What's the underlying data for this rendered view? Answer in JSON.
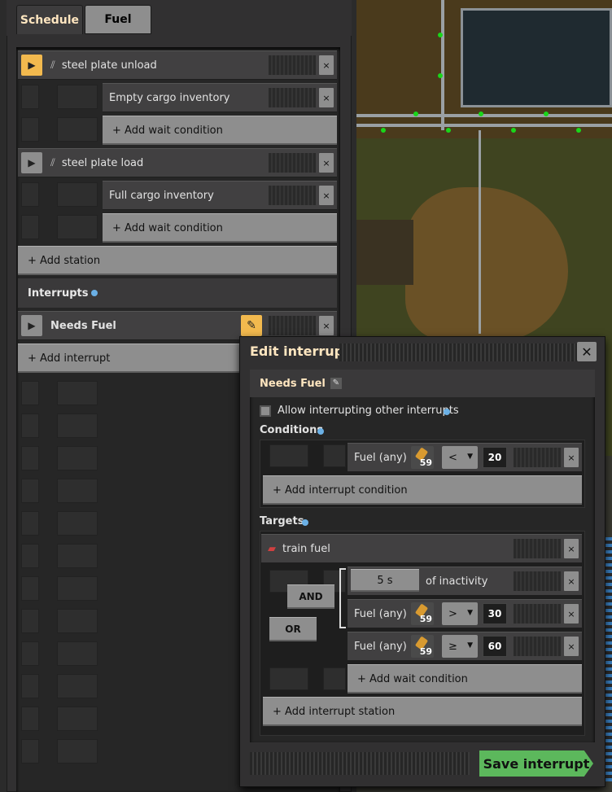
{
  "tabs": [
    {
      "label": "Schedule"
    },
    {
      "label": "Fuel"
    }
  ],
  "schedule": {
    "stations": [
      {
        "name": "steel plate unload",
        "conditions": [
          "Empty cargo inventory"
        ],
        "add_condition": "+ Add wait condition"
      },
      {
        "name": "steel plate load",
        "conditions": [
          "Full cargo inventory"
        ],
        "add_condition": "+ Add wait condition"
      }
    ],
    "add_station": "+ Add station",
    "interrupts_header": "Interrupts",
    "interrupt_name": "Needs Fuel",
    "add_interrupt": "+ Add interrupt"
  },
  "dialog": {
    "title": "Edit interrupt",
    "interrupt_name": "Needs Fuel",
    "allow_interrupting": "Allow interrupting other interrupts",
    "conditions_header": "Conditions",
    "condition": {
      "label": "Fuel (any)",
      "count": "59",
      "operator": "<",
      "value": "20"
    },
    "add_interrupt_condition": "+ Add interrupt condition",
    "targets_header": "Targets",
    "target_station": "train fuel",
    "wait": [
      {
        "kind": "time",
        "value": "5 s",
        "label": "of inactivity"
      },
      {
        "kind": "fuel",
        "label": "Fuel (any)",
        "count": "59",
        "operator": ">",
        "value": "30"
      },
      {
        "kind": "fuel",
        "label": "Fuel (any)",
        "count": "59",
        "operator": "≥",
        "value": "60"
      }
    ],
    "and_label": "AND",
    "or_label": "OR",
    "add_wait_condition": "+ Add wait condition",
    "add_interrupt_station": "+ Add interrupt station",
    "save_label": "Save interrupt"
  }
}
